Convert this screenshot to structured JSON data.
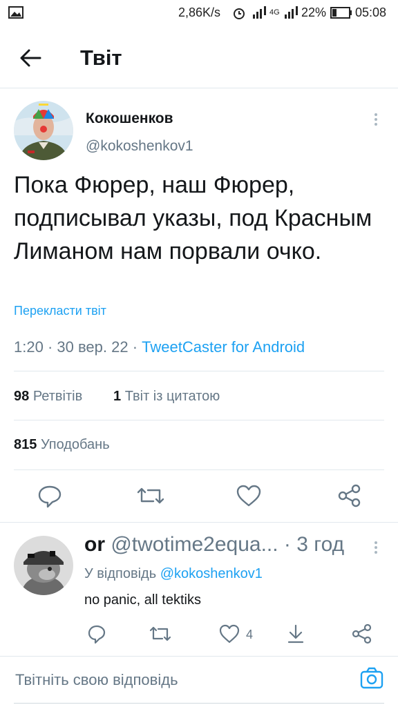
{
  "status_bar": {
    "speed": "2,86K/s",
    "network": "4G",
    "battery": "22%",
    "time": "05:08"
  },
  "header": {
    "title": "Твіт",
    "back_icon": "arrow-left-icon"
  },
  "tweet": {
    "display_name": "Кокошенков",
    "handle": "@kokoshenkov1",
    "text": "Пока Фюрер, наш Фюрер, подписывал указы, под Красным Лиманом нам порвали очко.",
    "translate_label": "Перекласти твіт",
    "time": "1:20",
    "date": "30 вер. 22",
    "source": "TweetCaster for Android",
    "retweets_count": "98",
    "retweets_label": "Ретвітів",
    "quotes_count": "1",
    "quotes_label": "Твіт із цитатою",
    "likes_count": "815",
    "likes_label": "Уподобань"
  },
  "reply": {
    "display_name": "or",
    "handle": "@twotime2equa...",
    "time": "3 год",
    "reply_to_prefix": "У відповідь",
    "reply_to_handle": "@kokoshenkov1",
    "text": "no panic, all tektiks",
    "likes": "4"
  },
  "composer": {
    "placeholder": "Твітніть свою відповідь"
  },
  "colors": {
    "accent": "#1da1f2",
    "muted": "#657786",
    "divider": "#e1e8ed"
  }
}
